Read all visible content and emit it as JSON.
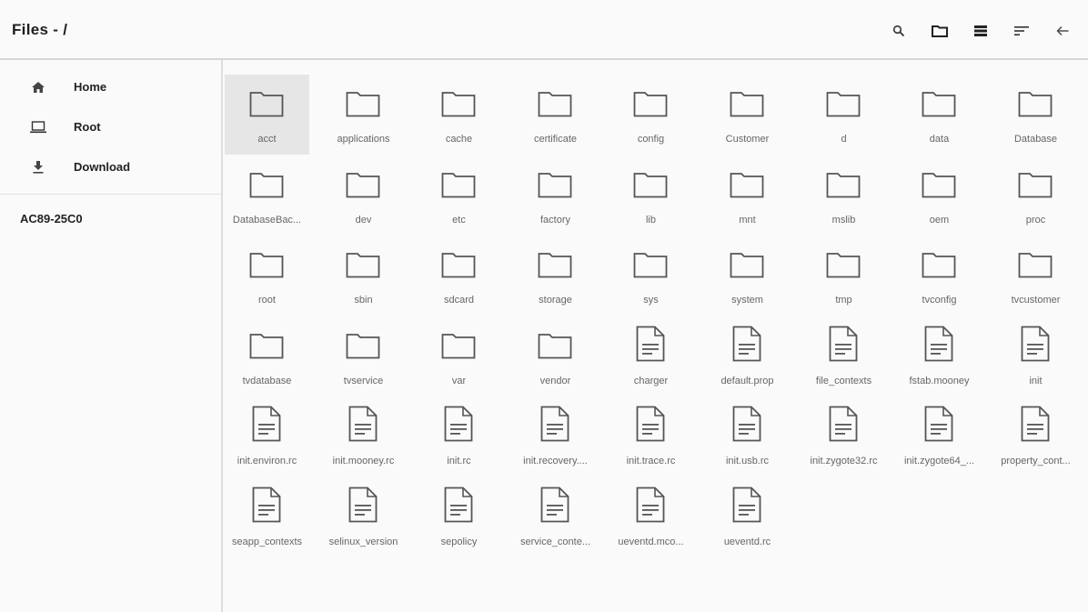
{
  "appbar": {
    "title": "Files - /",
    "actions": [
      {
        "icon": "search-icon"
      },
      {
        "icon": "new-folder-icon"
      },
      {
        "icon": "list-view-icon"
      },
      {
        "icon": "sort-icon"
      },
      {
        "icon": "back-arrow-icon"
      }
    ]
  },
  "sidebar": {
    "items": [
      {
        "label": "Home",
        "icon": "home-icon"
      },
      {
        "label": "Root",
        "icon": "laptop-icon"
      },
      {
        "label": "Download",
        "icon": "download-icon"
      }
    ],
    "device": "AC89-25C0"
  },
  "files": [
    {
      "name": "acct",
      "type": "folder",
      "selected": true
    },
    {
      "name": "applications",
      "type": "folder"
    },
    {
      "name": "cache",
      "type": "folder"
    },
    {
      "name": "certificate",
      "type": "folder"
    },
    {
      "name": "config",
      "type": "folder"
    },
    {
      "name": "Customer",
      "type": "folder"
    },
    {
      "name": "d",
      "type": "folder"
    },
    {
      "name": "data",
      "type": "folder"
    },
    {
      "name": "Database",
      "type": "folder"
    },
    {
      "name": "DatabaseBac...",
      "type": "folder"
    },
    {
      "name": "dev",
      "type": "folder"
    },
    {
      "name": "etc",
      "type": "folder"
    },
    {
      "name": "factory",
      "type": "folder"
    },
    {
      "name": "lib",
      "type": "folder"
    },
    {
      "name": "mnt",
      "type": "folder"
    },
    {
      "name": "mslib",
      "type": "folder"
    },
    {
      "name": "oem",
      "type": "folder"
    },
    {
      "name": "proc",
      "type": "folder"
    },
    {
      "name": "root",
      "type": "folder"
    },
    {
      "name": "sbin",
      "type": "folder"
    },
    {
      "name": "sdcard",
      "type": "folder"
    },
    {
      "name": "storage",
      "type": "folder"
    },
    {
      "name": "sys",
      "type": "folder"
    },
    {
      "name": "system",
      "type": "folder"
    },
    {
      "name": "tmp",
      "type": "folder"
    },
    {
      "name": "tvconfig",
      "type": "folder"
    },
    {
      "name": "tvcustomer",
      "type": "folder"
    },
    {
      "name": "tvdatabase",
      "type": "folder"
    },
    {
      "name": "tvservice",
      "type": "folder"
    },
    {
      "name": "var",
      "type": "folder"
    },
    {
      "name": "vendor",
      "type": "folder"
    },
    {
      "name": "charger",
      "type": "file"
    },
    {
      "name": "default.prop",
      "type": "file"
    },
    {
      "name": "file_contexts",
      "type": "file"
    },
    {
      "name": "fstab.mooney",
      "type": "file"
    },
    {
      "name": "init",
      "type": "file"
    },
    {
      "name": "init.environ.rc",
      "type": "file"
    },
    {
      "name": "init.mooney.rc",
      "type": "file"
    },
    {
      "name": "init.rc",
      "type": "file"
    },
    {
      "name": "init.recovery....",
      "type": "file"
    },
    {
      "name": "init.trace.rc",
      "type": "file"
    },
    {
      "name": "init.usb.rc",
      "type": "file"
    },
    {
      "name": "init.zygote32.rc",
      "type": "file"
    },
    {
      "name": "init.zygote64_...",
      "type": "file"
    },
    {
      "name": "property_cont...",
      "type": "file"
    },
    {
      "name": "seapp_contexts",
      "type": "file"
    },
    {
      "name": "selinux_version",
      "type": "file"
    },
    {
      "name": "sepolicy",
      "type": "file"
    },
    {
      "name": "service_conte...",
      "type": "file"
    },
    {
      "name": "ueventd.mco...",
      "type": "file"
    },
    {
      "name": "ueventd.rc",
      "type": "file"
    }
  ]
}
